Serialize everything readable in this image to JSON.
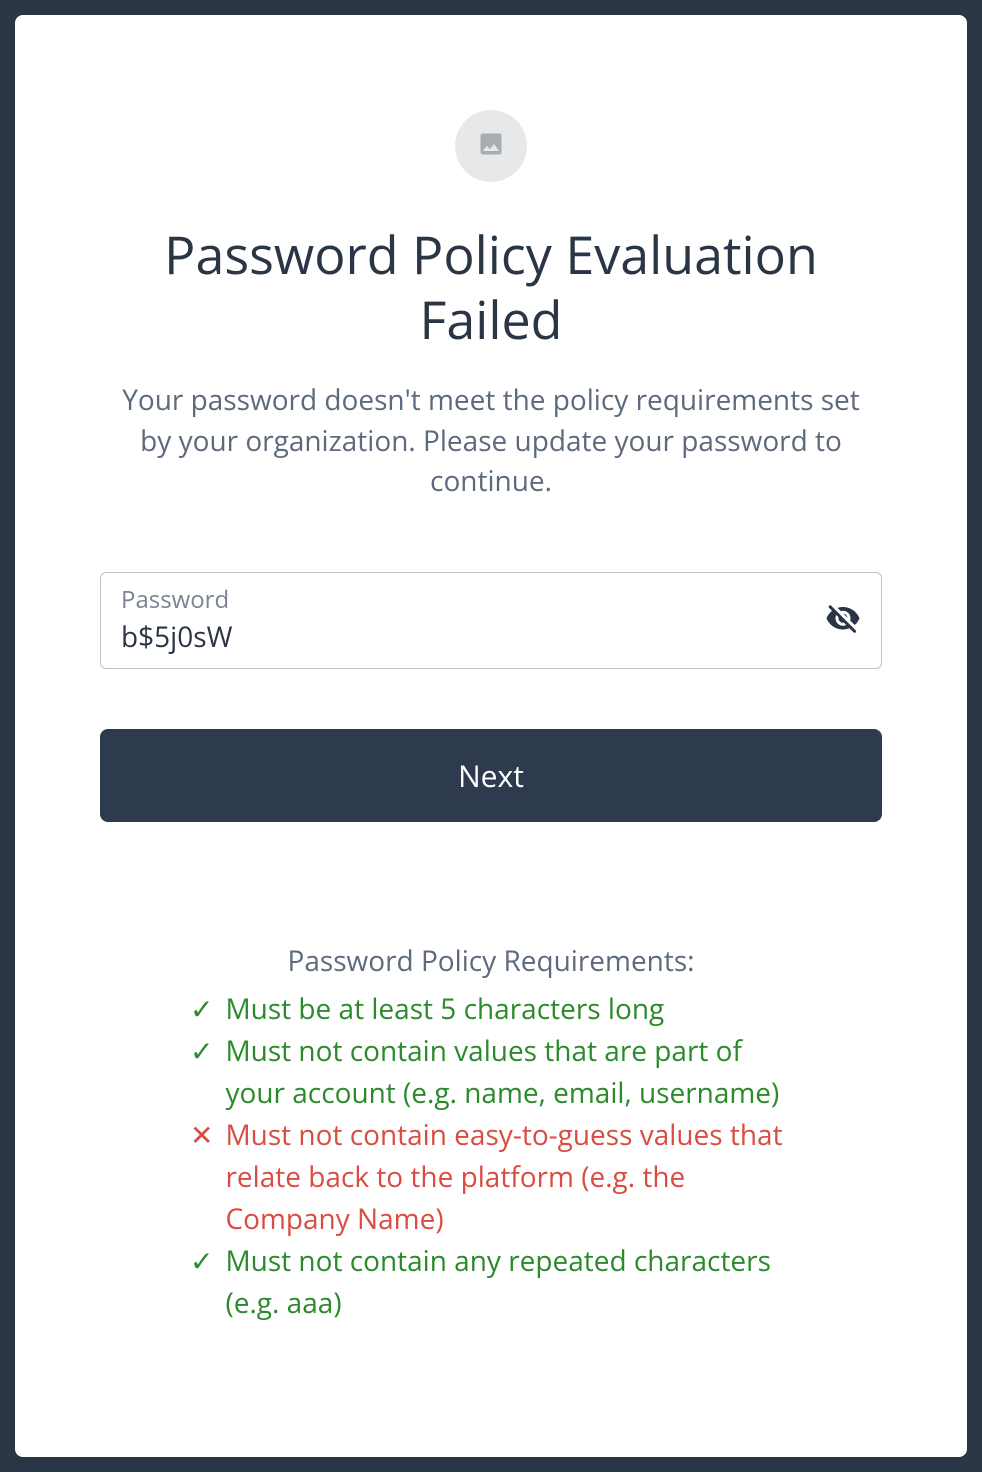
{
  "header": {
    "title": "Password Policy Evaluation Failed",
    "subtitle": "Your password doesn't meet the policy requirements set by your organization. Please update your password to continue."
  },
  "form": {
    "password_label": "Password",
    "password_value": "b$5j0sW",
    "next_button_label": "Next"
  },
  "requirements": {
    "title": "Password Policy Requirements:",
    "items": [
      {
        "status": "pass",
        "icon": "✓",
        "text": "Must be at least 5 characters long"
      },
      {
        "status": "pass",
        "icon": "✓",
        "text": "Must not contain values that are part of your account (e.g. name, email, username)"
      },
      {
        "status": "fail",
        "icon": "✕",
        "text": "Must not contain easy-to-guess values that relate back to the platform (e.g. the Company Name)"
      },
      {
        "status": "pass",
        "icon": "✓",
        "text": "Must not contain any repeated characters (e.g. aaa)"
      }
    ]
  },
  "colors": {
    "background": "#2a3646",
    "card": "#ffffff",
    "text_primary": "#2a3646",
    "text_secondary": "#5d6a7e",
    "button_bg": "#2e3a4d",
    "success": "#2b8a2b",
    "error": "#d94c42"
  }
}
